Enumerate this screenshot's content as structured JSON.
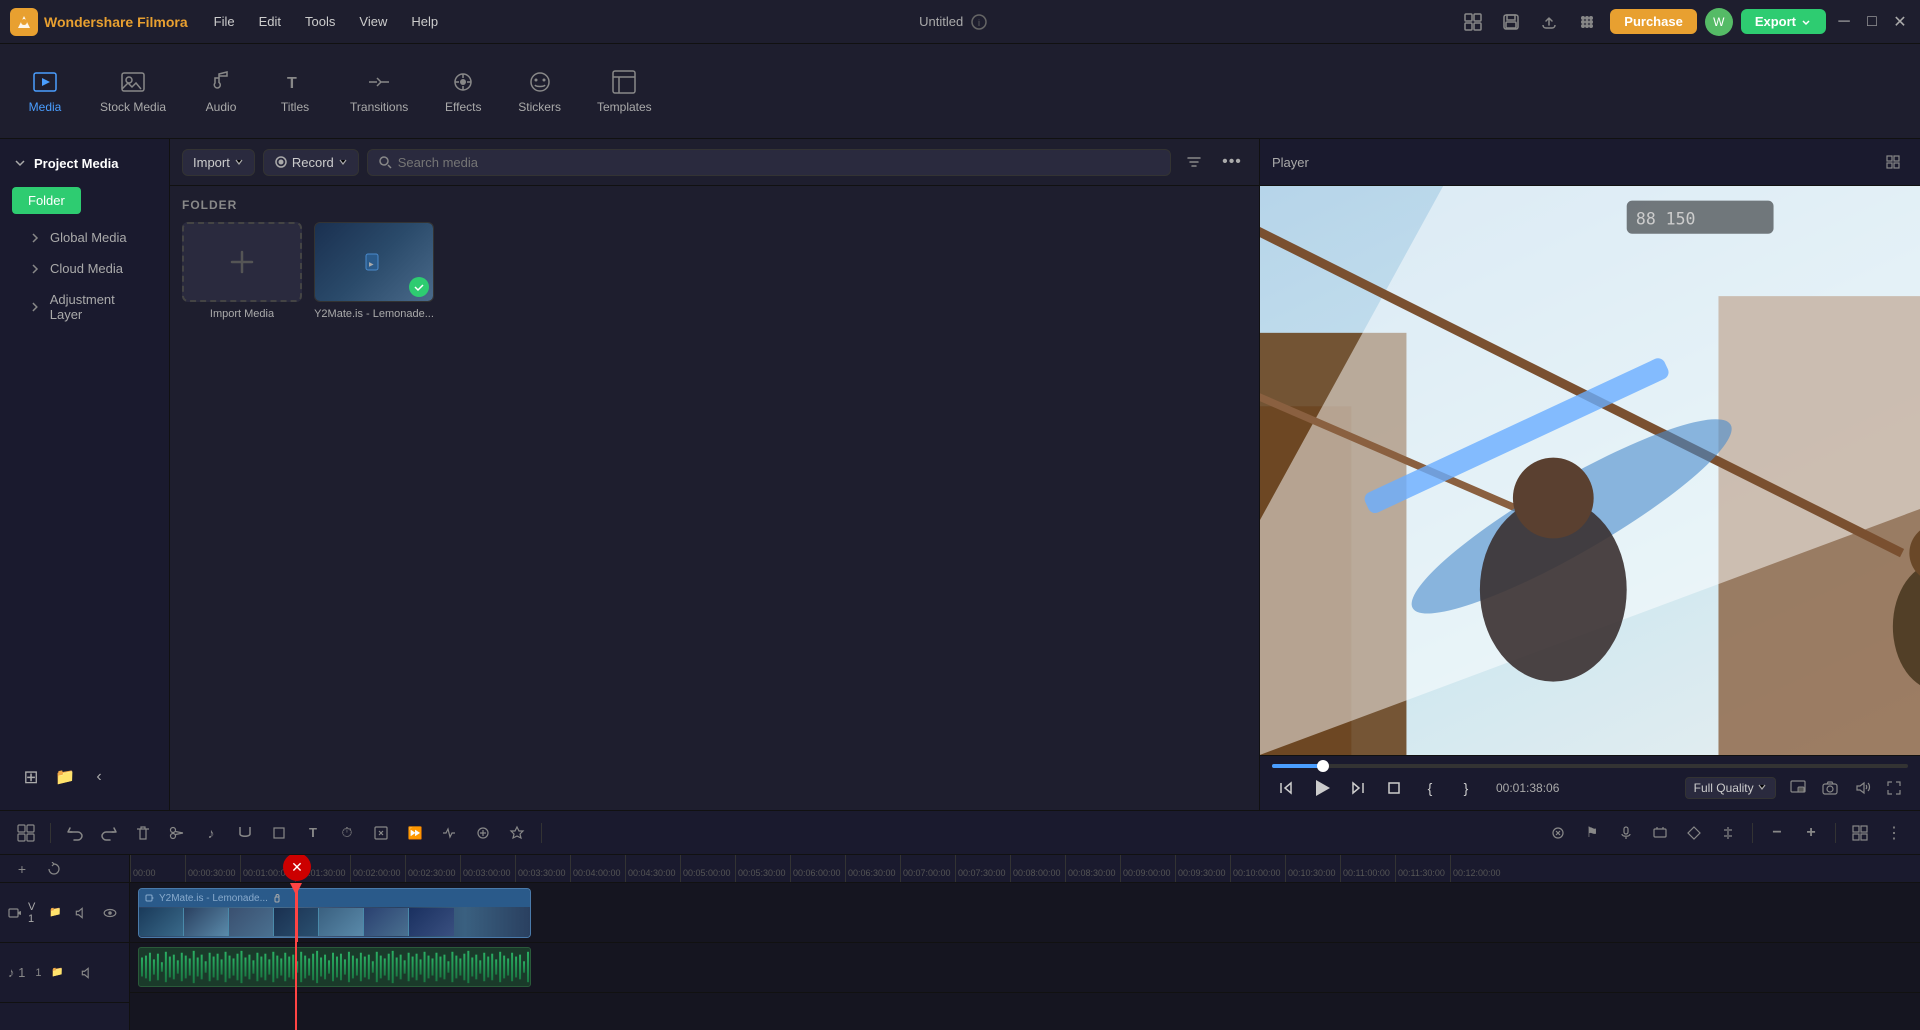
{
  "app": {
    "name": "Wondershare Filmora",
    "title": "Untitled",
    "logo_color": "#e8a030"
  },
  "titlebar": {
    "menu_items": [
      "File",
      "Edit",
      "Tools",
      "View",
      "Help"
    ],
    "purchase_label": "Purchase",
    "export_label": "Export"
  },
  "toolbar": {
    "items": [
      {
        "id": "media",
        "label": "Media",
        "active": true
      },
      {
        "id": "stock-media",
        "label": "Stock Media"
      },
      {
        "id": "audio",
        "label": "Audio"
      },
      {
        "id": "titles",
        "label": "Titles"
      },
      {
        "id": "transitions",
        "label": "Transitions"
      },
      {
        "id": "effects",
        "label": "Effects"
      },
      {
        "id": "stickers",
        "label": "Stickers"
      },
      {
        "id": "templates",
        "label": "Templates"
      }
    ]
  },
  "left_panel": {
    "header": "Project Media",
    "folder_label": "Folder",
    "items": [
      {
        "id": "global-media",
        "label": "Global Media"
      },
      {
        "id": "cloud-media",
        "label": "Cloud Media"
      },
      {
        "id": "adjustment-layer",
        "label": "Adjustment Layer"
      }
    ]
  },
  "media_panel": {
    "import_label": "Import",
    "record_label": "Record",
    "search_placeholder": "Search media",
    "folder_section": "FOLDER",
    "items": [
      {
        "id": "import",
        "label": "Import Media",
        "type": "import"
      },
      {
        "id": "clip1",
        "label": "Y2Mate.is - Lemonade...",
        "type": "video",
        "checked": true
      }
    ]
  },
  "player": {
    "header": "Player",
    "time": "00:01:38:06",
    "quality": "Full Quality",
    "progress_pct": 8
  },
  "timeline": {
    "video_track_label": "V 1",
    "audio_track_label": "♪ 1",
    "clip_name": "Y2Mate.is - Lemonade...",
    "playhead_position": "00:01:30:00",
    "ruler_marks": [
      "00:00",
      "00:00:30:00",
      "00:01:00:00",
      "00:01:30:00",
      "00:02:00:00",
      "00:02:30:00",
      "00:03:00:00",
      "00:03:30:00",
      "00:04:00:00",
      "00:04:30:00",
      "00:05:00:00",
      "00:05:30:00",
      "00:06:00:00",
      "00:06:30:00",
      "00:07:00:00",
      "00:07:30:00",
      "00:08:00:00",
      "00:08:30:00",
      "00:09:00:00",
      "00:09:30:00",
      "00:10:00:00",
      "00:10:30:00",
      "00:11:00:00",
      "00:11:30:00",
      "00:12:00:00"
    ]
  },
  "icons": {
    "chevron_right": "▶",
    "chevron_down": "▼",
    "search": "🔍",
    "plus": "+",
    "check": "✓",
    "close": "✕",
    "minimize": "─",
    "maximize": "□",
    "settings": "⚙",
    "filter": "⊞",
    "more": "•••",
    "undo": "↩",
    "redo": "↪",
    "delete": "🗑",
    "scissors": "✂",
    "music": "♪",
    "text": "T",
    "clock": "⏱",
    "crop": "⊡",
    "play": "▶",
    "pause": "⏸",
    "stop": "⏹",
    "prev": "⏮",
    "next": "⏭",
    "step_back": "⏪",
    "step_fwd": "⏩",
    "fullscreen": "⛶",
    "snapshot": "📷",
    "volume": "🔊",
    "pip": "⊞",
    "zoom_in": "+",
    "zoom_out": "−"
  }
}
